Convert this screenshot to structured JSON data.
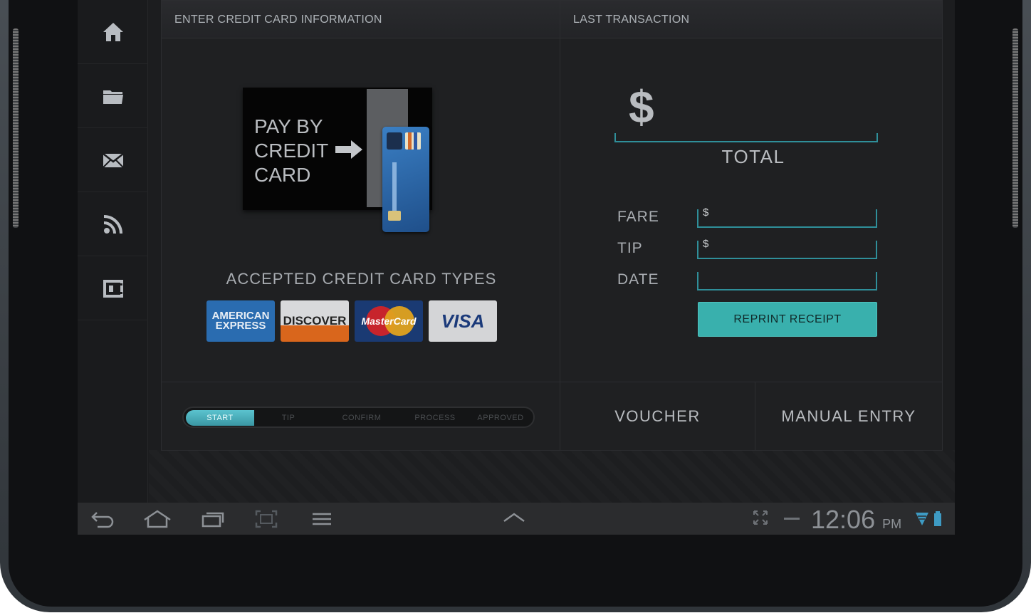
{
  "sidebar": {
    "items": [
      {
        "icon": "home-icon"
      },
      {
        "icon": "folder-icon"
      },
      {
        "icon": "mail-icon"
      },
      {
        "icon": "rss-icon"
      },
      {
        "icon": "safe-icon"
      }
    ]
  },
  "card_entry": {
    "header": "ENTER CREDIT CARD INFORMATION",
    "reader_lines": [
      "PAY BY",
      "CREDIT",
      "CARD"
    ],
    "accepted_title": "ACCEPTED CREDIT CARD TYPES",
    "card_types": [
      "AMERICAN EXPRESS",
      "DISCOVER",
      "MasterCard",
      "VISA"
    ]
  },
  "last_transaction": {
    "header": "LAST TRANSACTION",
    "currency": "$",
    "total_label": "TOTAL",
    "fare_label": "FARE",
    "fare_value": "$",
    "tip_label": "TIP",
    "tip_value": "$",
    "date_label": "DATE",
    "date_value": "",
    "reprint_label": "REPRINT RECEIPT"
  },
  "progress": {
    "steps": [
      "START",
      "TIP",
      "CONFIRM",
      "PROCESS",
      "APPROVED"
    ],
    "active_step": "START"
  },
  "actions": {
    "voucher_label": "VOUCHER",
    "manual_entry_label": "MANUAL ENTRY"
  },
  "system_bar": {
    "time": "12:06",
    "ampm": "PM"
  },
  "colors": {
    "accent": "#39b0ad",
    "underline": "#2f8f9a"
  }
}
